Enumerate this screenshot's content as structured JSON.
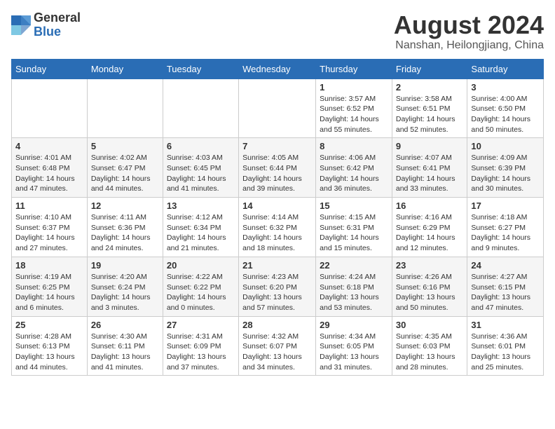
{
  "logo": {
    "general": "General",
    "blue": "Blue"
  },
  "title": "August 2024",
  "subtitle": "Nanshan, Heilongjiang, China",
  "days_of_week": [
    "Sunday",
    "Monday",
    "Tuesday",
    "Wednesday",
    "Thursday",
    "Friday",
    "Saturday"
  ],
  "weeks": [
    [
      {
        "day": "",
        "info": ""
      },
      {
        "day": "",
        "info": ""
      },
      {
        "day": "",
        "info": ""
      },
      {
        "day": "",
        "info": ""
      },
      {
        "day": "1",
        "info": "Sunrise: 3:57 AM\nSunset: 6:52 PM\nDaylight: 14 hours and 55 minutes."
      },
      {
        "day": "2",
        "info": "Sunrise: 3:58 AM\nSunset: 6:51 PM\nDaylight: 14 hours and 52 minutes."
      },
      {
        "day": "3",
        "info": "Sunrise: 4:00 AM\nSunset: 6:50 PM\nDaylight: 14 hours and 50 minutes."
      }
    ],
    [
      {
        "day": "4",
        "info": "Sunrise: 4:01 AM\nSunset: 6:48 PM\nDaylight: 14 hours and 47 minutes."
      },
      {
        "day": "5",
        "info": "Sunrise: 4:02 AM\nSunset: 6:47 PM\nDaylight: 14 hours and 44 minutes."
      },
      {
        "day": "6",
        "info": "Sunrise: 4:03 AM\nSunset: 6:45 PM\nDaylight: 14 hours and 41 minutes."
      },
      {
        "day": "7",
        "info": "Sunrise: 4:05 AM\nSunset: 6:44 PM\nDaylight: 14 hours and 39 minutes."
      },
      {
        "day": "8",
        "info": "Sunrise: 4:06 AM\nSunset: 6:42 PM\nDaylight: 14 hours and 36 minutes."
      },
      {
        "day": "9",
        "info": "Sunrise: 4:07 AM\nSunset: 6:41 PM\nDaylight: 14 hours and 33 minutes."
      },
      {
        "day": "10",
        "info": "Sunrise: 4:09 AM\nSunset: 6:39 PM\nDaylight: 14 hours and 30 minutes."
      }
    ],
    [
      {
        "day": "11",
        "info": "Sunrise: 4:10 AM\nSunset: 6:37 PM\nDaylight: 14 hours and 27 minutes."
      },
      {
        "day": "12",
        "info": "Sunrise: 4:11 AM\nSunset: 6:36 PM\nDaylight: 14 hours and 24 minutes."
      },
      {
        "day": "13",
        "info": "Sunrise: 4:12 AM\nSunset: 6:34 PM\nDaylight: 14 hours and 21 minutes."
      },
      {
        "day": "14",
        "info": "Sunrise: 4:14 AM\nSunset: 6:32 PM\nDaylight: 14 hours and 18 minutes."
      },
      {
        "day": "15",
        "info": "Sunrise: 4:15 AM\nSunset: 6:31 PM\nDaylight: 14 hours and 15 minutes."
      },
      {
        "day": "16",
        "info": "Sunrise: 4:16 AM\nSunset: 6:29 PM\nDaylight: 14 hours and 12 minutes."
      },
      {
        "day": "17",
        "info": "Sunrise: 4:18 AM\nSunset: 6:27 PM\nDaylight: 14 hours and 9 minutes."
      }
    ],
    [
      {
        "day": "18",
        "info": "Sunrise: 4:19 AM\nSunset: 6:25 PM\nDaylight: 14 hours and 6 minutes."
      },
      {
        "day": "19",
        "info": "Sunrise: 4:20 AM\nSunset: 6:24 PM\nDaylight: 14 hours and 3 minutes."
      },
      {
        "day": "20",
        "info": "Sunrise: 4:22 AM\nSunset: 6:22 PM\nDaylight: 14 hours and 0 minutes."
      },
      {
        "day": "21",
        "info": "Sunrise: 4:23 AM\nSunset: 6:20 PM\nDaylight: 13 hours and 57 minutes."
      },
      {
        "day": "22",
        "info": "Sunrise: 4:24 AM\nSunset: 6:18 PM\nDaylight: 13 hours and 53 minutes."
      },
      {
        "day": "23",
        "info": "Sunrise: 4:26 AM\nSunset: 6:16 PM\nDaylight: 13 hours and 50 minutes."
      },
      {
        "day": "24",
        "info": "Sunrise: 4:27 AM\nSunset: 6:15 PM\nDaylight: 13 hours and 47 minutes."
      }
    ],
    [
      {
        "day": "25",
        "info": "Sunrise: 4:28 AM\nSunset: 6:13 PM\nDaylight: 13 hours and 44 minutes."
      },
      {
        "day": "26",
        "info": "Sunrise: 4:30 AM\nSunset: 6:11 PM\nDaylight: 13 hours and 41 minutes."
      },
      {
        "day": "27",
        "info": "Sunrise: 4:31 AM\nSunset: 6:09 PM\nDaylight: 13 hours and 37 minutes."
      },
      {
        "day": "28",
        "info": "Sunrise: 4:32 AM\nSunset: 6:07 PM\nDaylight: 13 hours and 34 minutes."
      },
      {
        "day": "29",
        "info": "Sunrise: 4:34 AM\nSunset: 6:05 PM\nDaylight: 13 hours and 31 minutes."
      },
      {
        "day": "30",
        "info": "Sunrise: 4:35 AM\nSunset: 6:03 PM\nDaylight: 13 hours and 28 minutes."
      },
      {
        "day": "31",
        "info": "Sunrise: 4:36 AM\nSunset: 6:01 PM\nDaylight: 13 hours and 25 minutes."
      }
    ]
  ]
}
